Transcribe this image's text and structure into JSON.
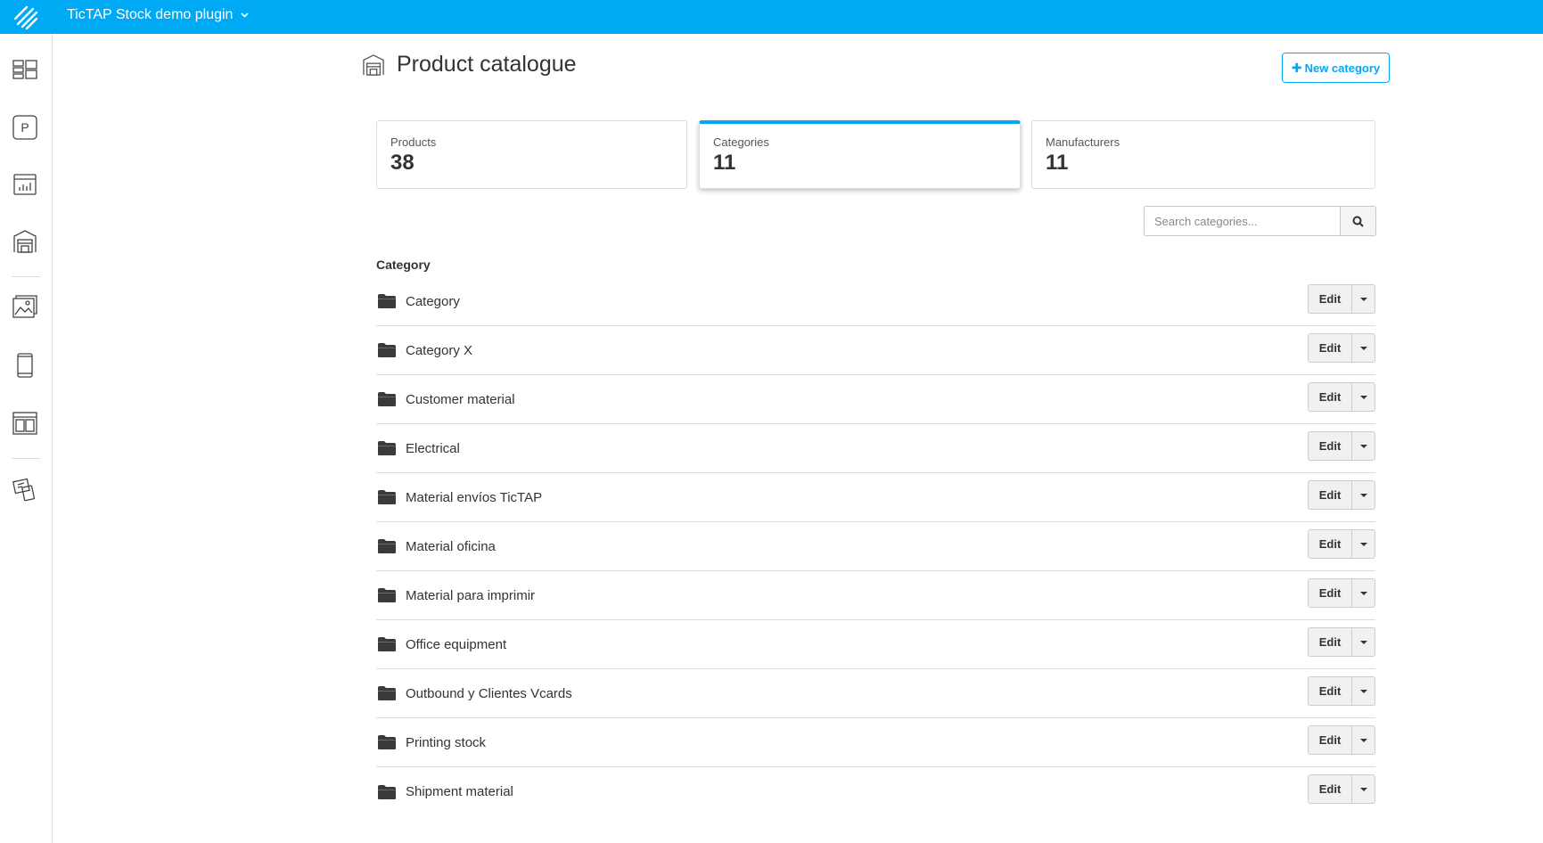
{
  "app": {
    "title": "TicTAP Stock demo plugin",
    "accent_color": "#00a9f4"
  },
  "sidebar": {
    "items": [
      {
        "icon": "dashboard-icon"
      },
      {
        "icon": "p-badge-icon",
        "text": "P"
      },
      {
        "icon": "chart-icon"
      },
      {
        "icon": "warehouse-icon"
      },
      {
        "icon": "image-gallery-icon"
      },
      {
        "icon": "mobile-phone-icon"
      },
      {
        "icon": "layout-icon"
      },
      {
        "icon": "devices-icon"
      }
    ]
  },
  "page": {
    "title": "Product catalogue",
    "title_icon": "warehouse-icon",
    "new_button_label": "New category"
  },
  "stats": [
    {
      "label": "Products",
      "value": "38",
      "active": false
    },
    {
      "label": "Categories",
      "value": "11",
      "active": true
    },
    {
      "label": "Manufacturers",
      "value": "11",
      "active": false
    }
  ],
  "search": {
    "placeholder": "Search categories...",
    "value": ""
  },
  "list": {
    "header": "Category",
    "edit_label": "Edit",
    "items": [
      "Category",
      "Category X",
      "Customer material",
      "Electrical",
      "Material envíos TicTAP",
      "Material oficina",
      "Material para imprimir",
      "Office equipment",
      "Outbound y Clientes Vcards",
      "Printing stock",
      "Shipment material"
    ]
  }
}
